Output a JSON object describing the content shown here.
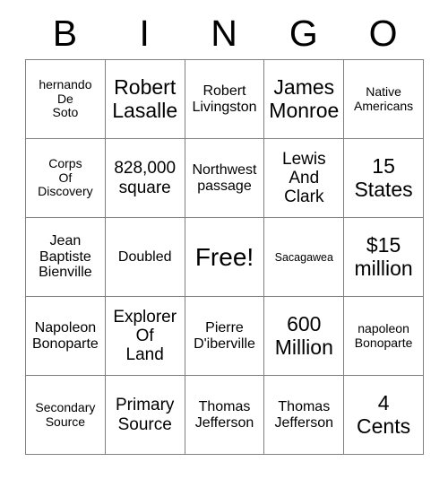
{
  "card": {
    "header_letters": [
      "B",
      "I",
      "N",
      "G",
      "O"
    ],
    "rows": [
      [
        {
          "text": "hernando\nDe\nSoto",
          "size": "sm"
        },
        {
          "text": "Robert\nLasalle",
          "size": "xl"
        },
        {
          "text": "Robert\nLivingston",
          "size": "md"
        },
        {
          "text": "James\nMonroe",
          "size": "xl"
        },
        {
          "text": "Native\nAmericans",
          "size": "sm"
        }
      ],
      [
        {
          "text": "Corps\nOf\nDiscovery",
          "size": "sm"
        },
        {
          "text": "828,000\nsquare",
          "size": "lg"
        },
        {
          "text": "Northwest\npassage",
          "size": "md"
        },
        {
          "text": "Lewis\nAnd\nClark",
          "size": "lg"
        },
        {
          "text": "15\nStates",
          "size": "xl"
        }
      ],
      [
        {
          "text": "Jean\nBaptiste\nBienville",
          "size": "md"
        },
        {
          "text": "Doubled",
          "size": "md"
        },
        {
          "text": "Free!",
          "size": "xxl"
        },
        {
          "text": "Sacagawea",
          "size": "xs"
        },
        {
          "text": "$15\nmillion",
          "size": "xl"
        }
      ],
      [
        {
          "text": "Napoleon\nBonoparte",
          "size": "md"
        },
        {
          "text": "Explorer\nOf\nLand",
          "size": "lg"
        },
        {
          "text": "Pierre\nD'iberville",
          "size": "md"
        },
        {
          "text": "600\nMillion",
          "size": "xl"
        },
        {
          "text": "napoleon\nBonoparte",
          "size": "sm"
        }
      ],
      [
        {
          "text": "Secondary\nSource",
          "size": "sm"
        },
        {
          "text": "Primary\nSource",
          "size": "lg"
        },
        {
          "text": "Thomas\nJefferson",
          "size": "md"
        },
        {
          "text": "Thomas\nJefferson",
          "size": "md"
        },
        {
          "text": "4\nCents",
          "size": "xl"
        }
      ]
    ],
    "free_space": {
      "row": 2,
      "col": 2,
      "label": "Free!"
    },
    "colors": {
      "text": "#000000",
      "grid_border": "#808080",
      "background": "#ffffff"
    }
  }
}
